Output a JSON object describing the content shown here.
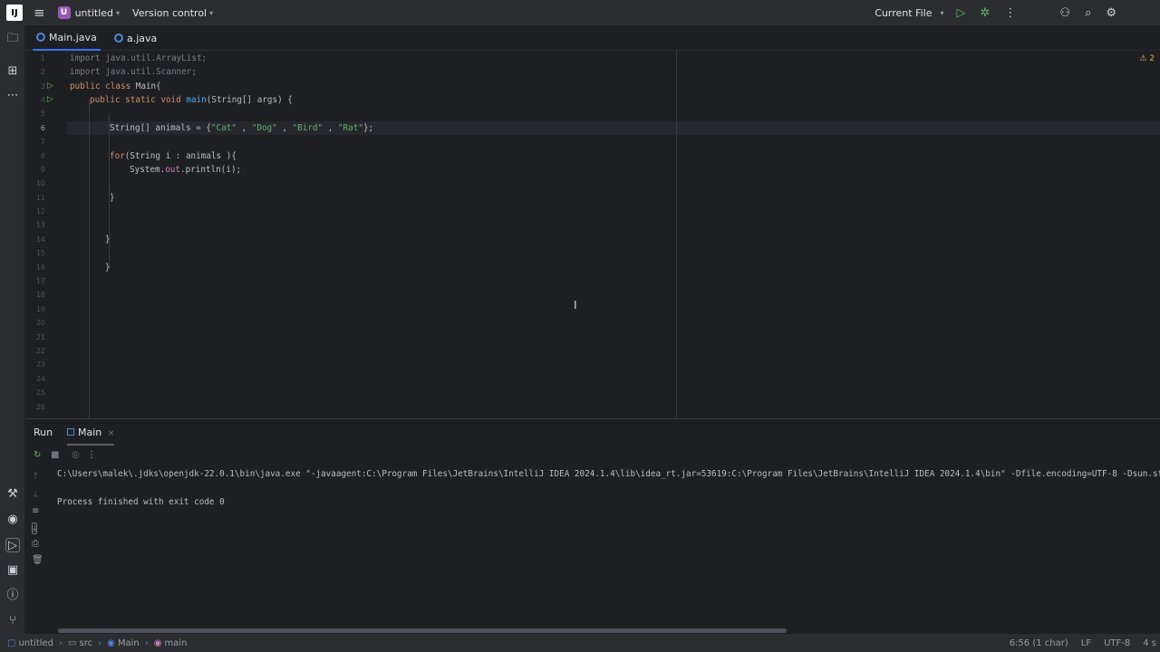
{
  "titlebar": {
    "logo": "IJ",
    "project_badge": "U",
    "project": "untitled",
    "version_control": "Version control",
    "run_config": "Current File"
  },
  "tabs": [
    {
      "label": "Main.java",
      "active": true
    },
    {
      "label": "a.java",
      "active": false
    }
  ],
  "editor": {
    "warning_count": "2",
    "line_numbers": [
      "1",
      "2",
      "3",
      "4",
      "5",
      "6",
      "7",
      "8",
      "9",
      "10",
      "11",
      "12",
      "13",
      "14",
      "15",
      "16",
      "17",
      "18",
      "19",
      "20",
      "21",
      "22",
      "23",
      "24",
      "25",
      "26"
    ],
    "current_line": "6",
    "lines": {
      "l1_kw": "import",
      "l1_rest": " java.util.ArrayList;",
      "l2_kw": "import",
      "l2_rest": " java.util.Scanner;",
      "l3_kw": "public class",
      "l3_rest": " Main{",
      "l4_kw": "public static void",
      "l4_fn": "main",
      "l4_rest": "(String[] args) {",
      "l6_a": "String[] animals = {",
      "l6_s1": "\"Cat\"",
      "l6_c1": " , ",
      "l6_s2": "\"Dog\"",
      "l6_c2": " , ",
      "l6_s3": "\"Bird\"",
      "l6_c3": " , ",
      "l6_s4": "\"Rat\"",
      "l6_end": "};",
      "l8_kw": "for",
      "l8_rest": "(String i : animals ){",
      "l9_a": "System.",
      "l9_fld": "out",
      "l9_rest": ".println(i);",
      "l11": "}",
      "l14": "}",
      "l16": "}"
    }
  },
  "run_panel": {
    "tab_run": "Run",
    "tab_main": "Main",
    "command": "C:\\Users\\malek\\.jdks\\openjdk-22.0.1\\bin\\java.exe \"-javaagent:C:\\Program Files\\JetBrains\\IntelliJ IDEA 2024.1.4\\lib\\idea_rt.jar=53619:C:\\Program Files\\JetBrains\\IntelliJ IDEA 2024.1.4\\bin\" -Dfile.encoding=UTF-8 -Dsun.st",
    "result": "Process finished with exit code 0"
  },
  "statusbar": {
    "crumbs": [
      "untitled",
      "src",
      "Main",
      "main"
    ],
    "position": "6:56 (1 char)",
    "line_sep": "LF",
    "encoding": "UTF-8",
    "indent": "4 s"
  }
}
